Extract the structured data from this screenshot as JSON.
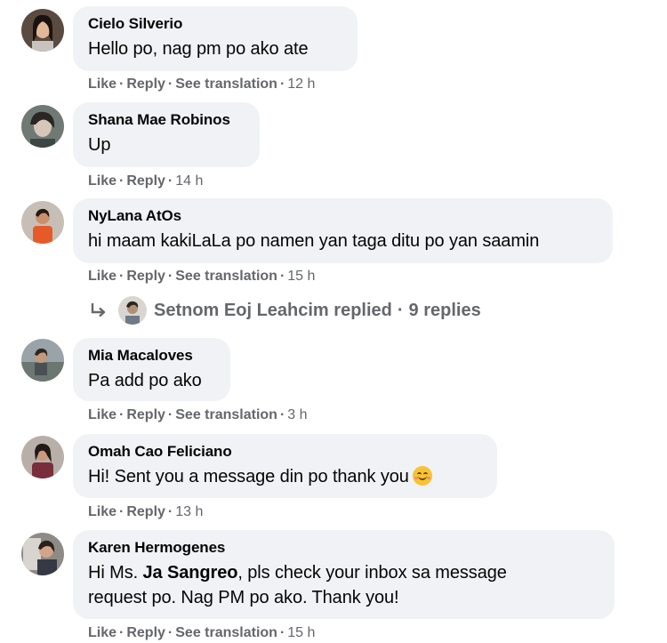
{
  "comments": [
    {
      "author": "Cielo Silverio",
      "text": "Hello po, nag pm po ako ate",
      "like": "Like",
      "reply": "Reply",
      "translate": "See translation",
      "time": "12 h"
    },
    {
      "author": "Shana Mae Robinos",
      "text": "Up",
      "like": "Like",
      "reply": "Reply",
      "time": "14 h"
    },
    {
      "author": "NyLana AtOs",
      "text": "hi maam kakiLaLa po namen yan taga ditu po yan saamin",
      "like": "Like",
      "reply": "Reply",
      "translate": "See translation",
      "time": "15 h"
    },
    {
      "author": "Mia Macaloves",
      "text": "Pa add po ako",
      "like": "Like",
      "reply": "Reply",
      "translate": "See translation",
      "time": "3 h"
    },
    {
      "author": "Omah Cao Feliciano",
      "text": "Hi! Sent you a message din po thank you",
      "like": "Like",
      "reply": "Reply",
      "time": "13 h"
    },
    {
      "author": "Karen Hermogenes",
      "text_pre": "Hi Ms. ",
      "mention": "Ja Sangreo",
      "text_post": ", pls check your inbox sa message",
      "text_line2": "request po. Nag PM po ako. Thank you!",
      "like": "Like",
      "reply": "Reply",
      "translate": "See translation",
      "time": "15 h"
    }
  ],
  "replies_summary": {
    "author": "Setnom Eoj Leahcim",
    "action": "replied",
    "separator": "·",
    "count_text": "9 replies"
  },
  "separator": "·",
  "icons": {
    "reply_arrow": "reply-arrow-icon",
    "emoji": "smiling-face-icon"
  },
  "colors": {
    "bubble": "#f0f2f5",
    "meta": "#65676b",
    "text": "#050505"
  }
}
